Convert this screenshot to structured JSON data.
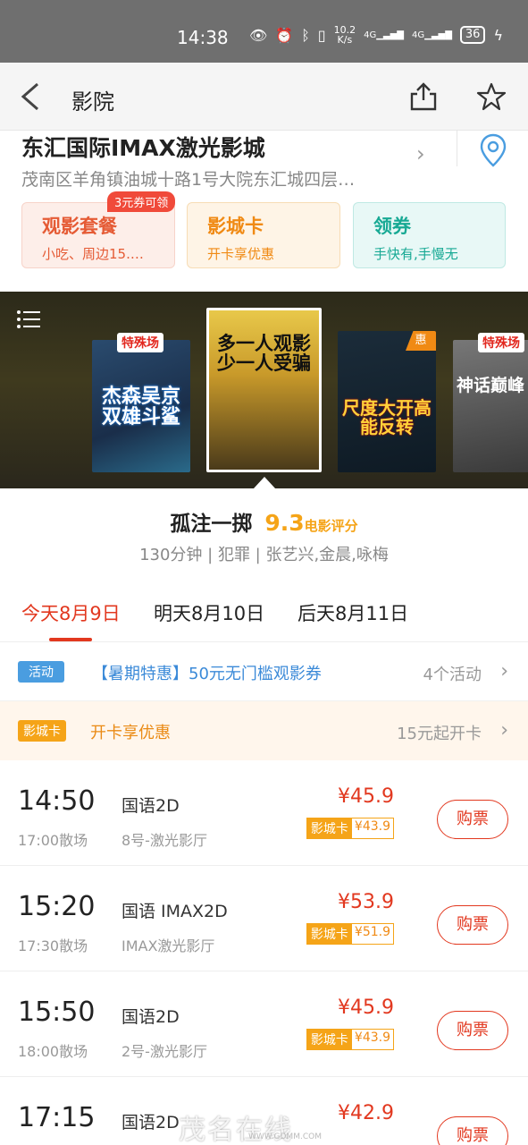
{
  "status_bar": {
    "time": "14:38",
    "speed_top": "10.2",
    "speed_bottom": "K/s",
    "signal_1": "4G",
    "signal_2": "4G",
    "battery": "36"
  },
  "nav": {
    "title": "影院"
  },
  "cinema": {
    "name": "东汇国际IMAX激光影城",
    "address": "茂南区羊角镇油城十路1号大院东汇城四层…",
    "promos": [
      {
        "title": "观影套餐",
        "sub": "小吃、周边15.…",
        "badge": "3元券可领"
      },
      {
        "title": "影城卡",
        "sub": "开卡享优惠"
      },
      {
        "title": "领券",
        "sub": "手快有,手慢无"
      }
    ]
  },
  "posters": [
    {
      "tag": "特殊场",
      "text": "杰森吴京双雄斗鲨"
    },
    {
      "text": "多一人观影少一人受骗"
    },
    {
      "corner": "惠",
      "text": "尺度大开高能反转"
    },
    {
      "tag": "特殊场",
      "text": "神话巅峰"
    }
  ],
  "movie": {
    "title": "孤注一掷",
    "score": "9.3",
    "score_label": "电影评分",
    "meta": "130分钟 | 犯罪 | 张艺兴,金晨,咏梅"
  },
  "dates": [
    {
      "label": "今天8月9日",
      "active": true
    },
    {
      "label": "明天8月10日",
      "active": false
    },
    {
      "label": "后天8月11日",
      "active": false
    }
  ],
  "activity": {
    "badge": "活动",
    "text": "【暑期特惠】50元无门槛观影券",
    "count": "4个活动"
  },
  "member_card": {
    "badge": "影城卡",
    "text": "开卡享优惠",
    "price": "15元起开卡"
  },
  "showtimes": [
    {
      "start": "14:50",
      "end": "17:00散场",
      "lang": "国语2D",
      "hall": "8号-激光影厅",
      "price": "¥45.9",
      "card_label": "影城卡",
      "card_price": "¥43.9",
      "button": "购票"
    },
    {
      "start": "15:20",
      "end": "17:30散场",
      "lang": "国语 IMAX2D",
      "hall": "IMAX激光影厅",
      "price": "¥53.9",
      "card_label": "影城卡",
      "card_price": "¥51.9",
      "button": "购票"
    },
    {
      "start": "15:50",
      "end": "18:00散场",
      "lang": "国语2D",
      "hall": "2号-激光影厅",
      "price": "¥45.9",
      "card_label": "影城卡",
      "card_price": "¥43.9",
      "button": "购票"
    },
    {
      "start": "17:15",
      "end": "",
      "lang": "国语2D",
      "hall": "",
      "price": "¥42.9",
      "card_label": "",
      "card_price": "",
      "button": "购票"
    }
  ],
  "watermark": {
    "text": "茂名在线",
    "url": "WWW.GDMM.COM"
  }
}
